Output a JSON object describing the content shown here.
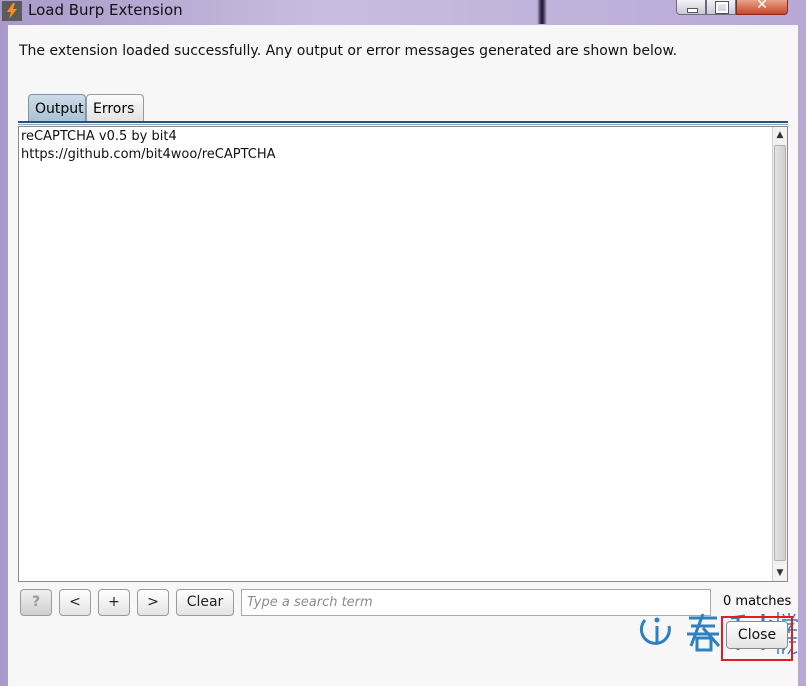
{
  "window": {
    "title": "Load Burp Extension",
    "icon": "burp-lightning-icon"
  },
  "message": "The extension loaded successfully. Any output or error messages generated are shown below.",
  "tabs": [
    {
      "label": "Output",
      "active": true
    },
    {
      "label": "Errors",
      "active": false
    }
  ],
  "output": {
    "lines": [
      "reCAPTCHA v0.5 by bit4",
      "https://github.com/bit4woo/reCAPTCHA"
    ]
  },
  "toolbar": {
    "help_label": "?",
    "prev_label": "<",
    "add_label": "+",
    "next_label": ">",
    "clear_label": "Clear",
    "search_placeholder": "Type a search term",
    "search_value": "",
    "matches_text": "0 matches"
  },
  "close_label": "Close",
  "colors": {
    "active_tab": "#b7cddc",
    "highlight_box": "#e02020",
    "watermark_blue": "#2f7fc1"
  }
}
